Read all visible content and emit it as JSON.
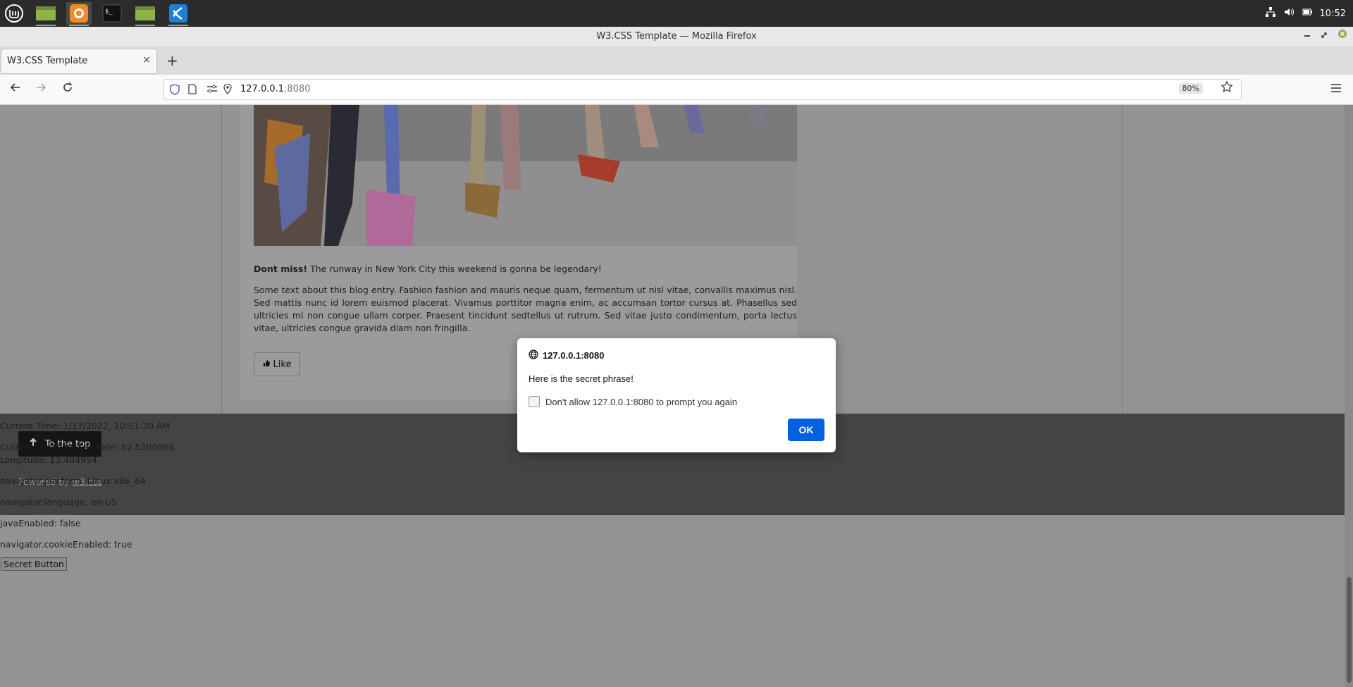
{
  "taskbar": {
    "apps": [
      {
        "icon": "mint-menu-icon"
      },
      {
        "icon": "desktop-folder-icon"
      },
      {
        "icon": "firefox-icon"
      },
      {
        "icon": "terminal-icon"
      },
      {
        "icon": "files-folder-icon"
      },
      {
        "icon": "vscode-icon"
      }
    ],
    "terminal_glyph": "$_",
    "clock": "10:52"
  },
  "window": {
    "title": "W3.CSS Template — Mozilla Firefox"
  },
  "tab": {
    "title": "W3.CSS Template",
    "close": "×",
    "new_tab": "+"
  },
  "navbar": {
    "url_host": "127.0.0.1",
    "url_port": ":8080",
    "zoom": "80%"
  },
  "blog": {
    "bold_lead": "Dont miss!",
    "lead": " The runway in New York City this weekend is gonna be legendary!",
    "body": "Some text about this blog entry. Fashion fashion and mauris neque quam, fermentum ut nisl vitae, convallis maximus nisl. Sed mattis nunc id lorem euismod placerat. Vivamus porttitor magna enim, ac accumsan tortor cursus at. Phasellus sed ultricies mi non congue ullam corper. Praesent tincidunt sedtellus ut rutrum. Sed vitae justo condimentum, porta lectus vitae, ultricies congue gravida diam non fringilla.",
    "like": "Like"
  },
  "footer": {
    "top_button": "To the top",
    "powered_prefix": "Powered by ",
    "powered_link": "w3.css"
  },
  "info": {
    "time": "Current Time: 1/17/2022, 10:51:30 AM",
    "location_lat": "Current Location: Latitude: 52.5200066",
    "location_lon": "Longitude: 13.404954",
    "platform": "navigator.platform: Linux x86_64",
    "language": "navigator.language: en-US",
    "java": "javaEnabled: false",
    "cookie": "navigator.cookieEnabled: true",
    "secret_button": "Secret Button"
  },
  "dialog": {
    "origin": "127.0.0.1:8080",
    "message": "Here is the secret phrase!",
    "checkbox_label": "Don't allow 127.0.0.1:8080 to prompt you again",
    "ok": "OK"
  }
}
